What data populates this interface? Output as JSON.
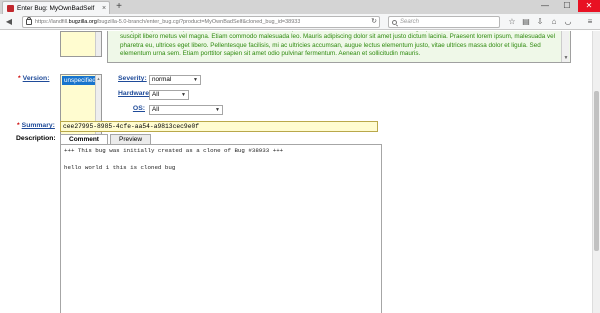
{
  "browser": {
    "tab_title": "Enter Bug: MyOwnBadSelf",
    "tab_close": "×",
    "new_tab": "+",
    "url_host": "https://landfill.",
    "url_domain": "bugzilla.org",
    "url_path": "/bugzilla-5.0-branch/enter_bug.cgi?product=MyOwnBadSelf&cloned_bug_id=38933",
    "search_placeholder": "Search",
    "window_controls": {
      "minimize": "—",
      "maximize": "☐",
      "close": "✕"
    }
  },
  "form": {
    "product_description": "congue neque, a suscipit risus eleifend non. In hac habitasse platea dictumst. Aenean elementum, lacus eget pulvinar molestie, urna leo iaculis risus, eu suscipit libero metus vel magna. Etiam commodo malesuada leo. Mauris adipiscing dolor sit amet justo dictum lacinia. Praesent lorem ipsum, malesuada vel pharetra eu, ultrices eget libero. Pellentesque facilisis, mi ac ultricies accumsan, augue lectus elementum justo, vitae ultrices massa dolor et ligula. Sed elementum urna sem. Etiam porttitor sapien sit amet odio pulvinar fermentum. Aenean et sollicitudin mauris.",
    "version": {
      "label": "Version:",
      "selected": "unspecified",
      "required": "*"
    },
    "severity": {
      "label": "Severity:",
      "value": "normal"
    },
    "hardware": {
      "label": "Hardware:",
      "value": "All"
    },
    "os": {
      "label": "OS:",
      "value": "All"
    },
    "summary": {
      "label": "Summary:",
      "value": "cee27995-8985-4cfe-aa54-a9813cec9e0f",
      "required": "*"
    },
    "description": {
      "label": "Description:",
      "tabs": [
        "Comment",
        "Preview"
      ],
      "text": "+++ This bug was initially created as a clone of Bug #38933 +++\n\nhello world 1 this is cloned bug"
    }
  }
}
